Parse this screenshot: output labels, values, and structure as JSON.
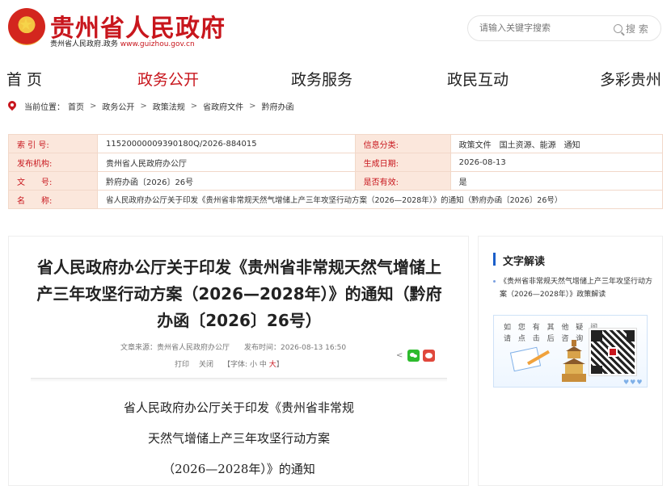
{
  "header": {
    "title": "贵州省人民政府",
    "sub_prefix": "贵州省人民政府.政务",
    "url": "www.guizhou.gov.cn"
  },
  "search": {
    "placeholder": "请输入关键字搜索",
    "button_label": "搜 索"
  },
  "nav": {
    "items": [
      {
        "label": "首 页"
      },
      {
        "label": "政务公开"
      },
      {
        "label": "政务服务"
      },
      {
        "label": "政民互动"
      },
      {
        "label": "多彩贵州"
      }
    ],
    "active_index": 1
  },
  "breadcrumb": {
    "prefix": "当前位置：",
    "items": [
      "首页",
      "政务公开",
      "政策法规",
      "省政府文件",
      "黔府办函"
    ],
    "separator": ">"
  },
  "meta": {
    "rows": [
      {
        "k1": "索 引 号:",
        "v1": "11520000009390180Q/2026-884015",
        "k2": "信息分类:",
        "v2": "政策文件　国土资源、能源　通知"
      },
      {
        "k1": "发布机构:",
        "v1": "贵州省人民政府办公厅",
        "k2": "生成日期:",
        "v2": "2026-08-13"
      },
      {
        "k1": "文　　号:",
        "v1": "黔府办函〔2026〕26号",
        "k2": "是否有效:",
        "v2": "是"
      }
    ],
    "name_label": "名　　称:",
    "name_value": "省人民政府办公厅关于印发《贵州省非常规天然气增储上产三年攻坚行动方案（2026—2028年）》的通知（黔府办函〔2026〕26号）"
  },
  "article": {
    "title_lines": [
      "省人民政府办公厅关于印发《贵州省非常规天然气增储上",
      "产三年攻坚行动方案（2026—2028年）》的通知（黔府",
      "办函〔2026〕26号）"
    ],
    "source": "文章来源：贵州省人民政府办公厅　　发布时间：2026-08-13 16:50",
    "print_label": "打印",
    "close_label": "关闭",
    "font_label": "【字体:",
    "font_small": "小",
    "font_mid": "中",
    "font_big": "大",
    "font_end": "】",
    "body_lines": [
      "省人民政府办公厅关于印发《贵州省非常规",
      "天然气增储上产三年攻坚行动方案",
      "（2026—2028年）》的通知"
    ]
  },
  "side": {
    "heading": "文字解读",
    "link": "《贵州省非常规天然气增储上产三年攻坚行动方案（2026—2028年）》政策解读",
    "banner_line1": "如 您 有 其 他 疑 问",
    "banner_line2": "请 点 击 后 咨 询"
  },
  "colors": {
    "brand_red": "#c8161d",
    "meta_label_bg": "#fbe7dc",
    "accent_blue": "#1a5ec9"
  }
}
